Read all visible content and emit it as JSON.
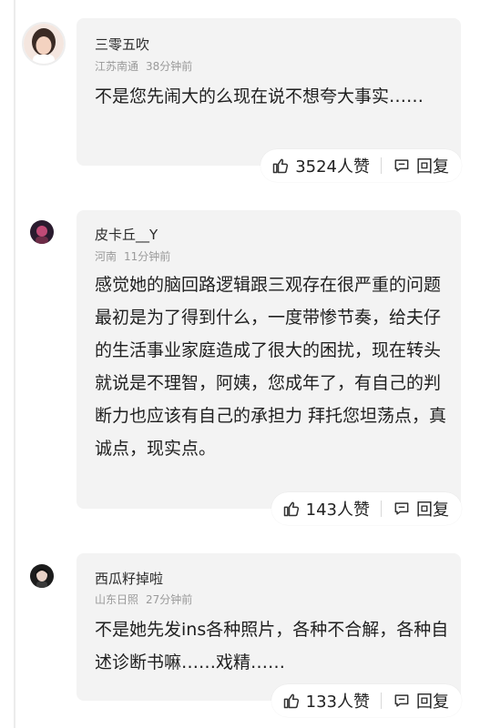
{
  "comments": [
    {
      "author": "三零五吹",
      "location": "江苏南通",
      "time": "38分钟前",
      "text": "不是您先闹大的么现在说不想夸大事实……",
      "likes_label": "3524人赞",
      "reply_label": "回复"
    },
    {
      "author": "皮卡丘__Y",
      "location": "河南",
      "time": "11分钟前",
      "text": "感觉她的脑回路逻辑跟三观存在很严重的问题 最初是为了得到什么，一度带惨节奏，给夫仔的生活事业家庭造成了很大的困扰，现在转头就说是不理智，阿姨，您成年了，有自己的判断力也应该有自己的承担力 拜托您坦荡点，真诚点，现实点。",
      "likes_label": "143人赞",
      "reply_label": "回复"
    },
    {
      "author": "西瓜籽掉啦",
      "location": "山东日照",
      "time": "27分钟前",
      "text": "不是她先发ins各种照片，各种不合解，各种自述诊断书嘛……戏精……",
      "likes_label": "133人赞",
      "reply_label": "回复"
    }
  ],
  "icons": {
    "like": "thumbs-up-icon",
    "reply": "comment-icon"
  },
  "colors": {
    "bubble": "#f3f3f3",
    "meta": "#9a9a9a"
  }
}
